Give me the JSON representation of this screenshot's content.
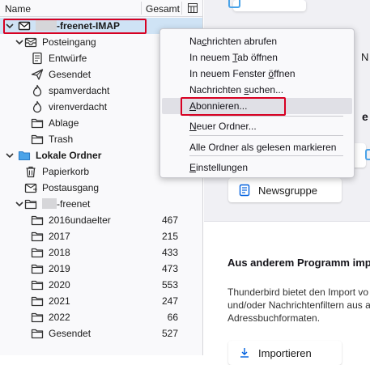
{
  "folder_pane": {
    "col_name": "Name",
    "col_total": "Gesamt",
    "account": {
      "name_suffix": "-freenet-IMAP"
    },
    "tree": [
      {
        "id": "posteingang",
        "label": "Posteingang",
        "icon": "inbox-icon",
        "count": ""
      },
      {
        "id": "entwuerfe",
        "label": "Entwürfe",
        "icon": "drafts-icon",
        "count": ""
      },
      {
        "id": "gesendet",
        "label": "Gesendet",
        "icon": "sent-icon",
        "count": ""
      },
      {
        "id": "spamverdacht",
        "label": "spamverdacht",
        "icon": "flame-icon",
        "count": ""
      },
      {
        "id": "virenverdacht",
        "label": "virenverdacht",
        "icon": "flame-icon",
        "count": ""
      },
      {
        "id": "ablage",
        "label": "Ablage",
        "icon": "folder-icon",
        "count": ""
      },
      {
        "id": "trash",
        "label": "Trash",
        "icon": "folder-icon",
        "count": ""
      },
      {
        "id": "lokale-ordner",
        "label": "Lokale Ordner",
        "icon": "local-folder-icon",
        "count": ""
      },
      {
        "id": "papierkorb",
        "label": "Papierkorb",
        "icon": "trash-icon",
        "count": ""
      },
      {
        "id": "postausgang",
        "label": "Postausgang",
        "icon": "outbox-icon",
        "count": ""
      },
      {
        "id": "freenet",
        "label": "-freenet",
        "icon": "folder-icon",
        "count": ""
      },
      {
        "id": "2016undaelter",
        "label": "2016undaelter",
        "icon": "folder-icon",
        "count": "467"
      },
      {
        "id": "2017",
        "label": "2017",
        "icon": "folder-icon",
        "count": "215"
      },
      {
        "id": "2018",
        "label": "2018",
        "icon": "folder-icon",
        "count": "433"
      },
      {
        "id": "2019",
        "label": "2019",
        "icon": "folder-icon",
        "count": "473"
      },
      {
        "id": "2020",
        "label": "2020",
        "icon": "folder-icon",
        "count": "553"
      },
      {
        "id": "2021",
        "label": "2021",
        "icon": "folder-icon",
        "count": "247"
      },
      {
        "id": "2022",
        "label": "2022",
        "icon": "folder-icon",
        "count": "66"
      },
      {
        "id": "gesendet2",
        "label": "Gesendet",
        "icon": "folder-icon",
        "count": "527"
      }
    ]
  },
  "context_menu": {
    "items": [
      {
        "id": "abrufen",
        "pre": "Na",
        "key": "c",
        "post": "hrichten abrufen"
      },
      {
        "id": "tab",
        "pre": "In neuem ",
        "key": "T",
        "post": "ab öffnen"
      },
      {
        "id": "fenster",
        "pre": "In neuem Fenster ",
        "key": "ö",
        "post": "ffnen"
      },
      {
        "id": "suchen",
        "pre": "Nachrichten ",
        "key": "s",
        "post": "uchen..."
      },
      {
        "id": "abonnieren",
        "pre": "",
        "key": "A",
        "post": "bonnieren..."
      },
      {
        "id": "neuer-ordner",
        "pre": "",
        "key": "N",
        "post": "euer Ordner..."
      },
      {
        "id": "gelesen",
        "pre": "Alle Ordner als ",
        "key": "g",
        "post": "elesen markieren"
      },
      {
        "id": "einstellungen",
        "pre": "",
        "key": "E",
        "post": "instellungen"
      }
    ]
  },
  "main_pane": {
    "n_fragment": "N",
    "e_fragment": "e",
    "newsgroup_button": "Newsgruppe",
    "import_heading": "Aus anderem Programm imp",
    "import_text_1": "Thunderbird bietet den Import vo",
    "import_text_2": "und/oder Nachrichtenfiltern aus a",
    "import_text_3": "Adressbuchformaten.",
    "import_button": "Importieren"
  },
  "colors": {
    "accent_red": "#d70022",
    "selection": "#cfe3f5",
    "folder_blue": "#4ba3e8",
    "link_blue": "#0060df"
  }
}
